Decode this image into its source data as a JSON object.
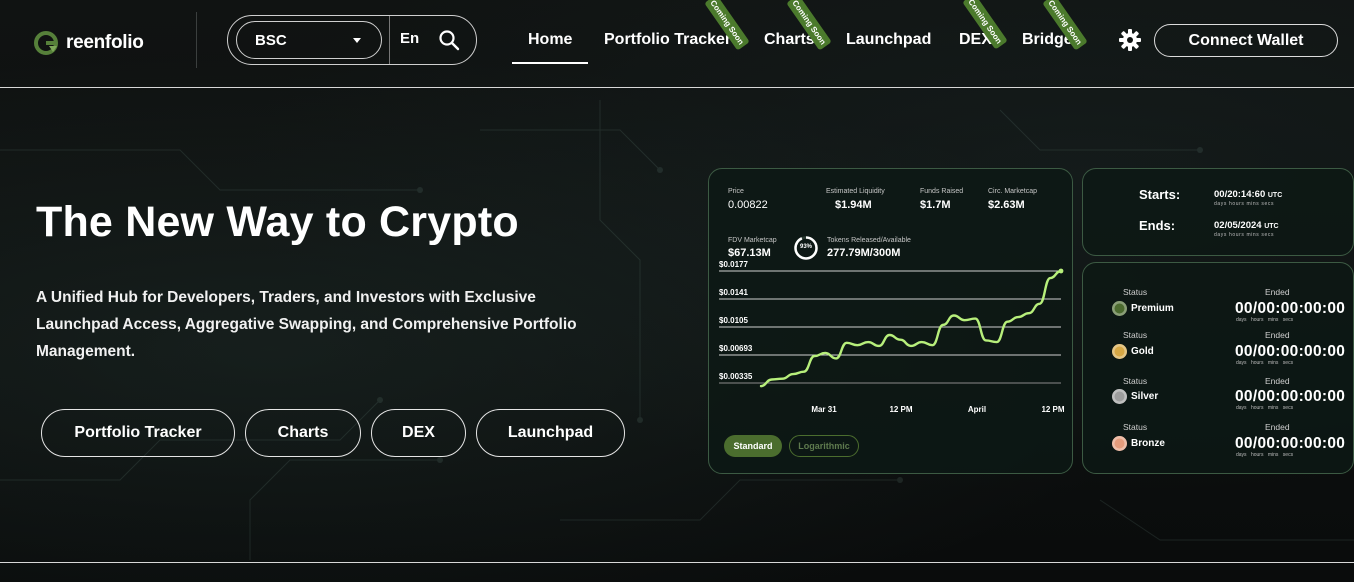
{
  "header": {
    "logo_text": "reenfolio",
    "chain": "BSC",
    "language": "En",
    "nav": [
      {
        "label": "Home",
        "active": true
      },
      {
        "label": "Portfolio Tracker",
        "badge": "Coming Soon"
      },
      {
        "label": "Charts",
        "badge": "Coming Soon"
      },
      {
        "label": "Launchpad"
      },
      {
        "label": "DEX",
        "badge": "Coming Soon"
      },
      {
        "label": "Bridge",
        "badge": "Coming Soon"
      }
    ],
    "connect_label": "Connect Wallet"
  },
  "hero": {
    "title": "The New Way to Crypto",
    "subtitle": "A Unified Hub for Developers, Traders, and Investors with Exclusive Launchpad Access, Aggregative Swapping, and Comprehensive Portfolio Management.",
    "buttons": [
      "Portfolio Tracker",
      "Charts",
      "DEX",
      "Launchpad"
    ]
  },
  "stats": {
    "price_label": "Price",
    "price": "0.00822",
    "liquidity_label": "Estimated Liquidity",
    "liquidity": "$1.94M",
    "funds_label": "Funds Raised",
    "funds": "$1.7M",
    "mcap_label": "Circ. Marketcap",
    "mcap": "$2.63M",
    "fdv_label": "FDV Marketcap",
    "fdv": "$67.13M",
    "released_percent": "93%",
    "tokens_label": "Tokens Released/Available",
    "tokens": "277.79M/300M"
  },
  "chart_data": {
    "type": "line",
    "y_ticks": [
      "$0.0177",
      "$0.0141",
      "$0.0105",
      "$0.00693",
      "$0.00335"
    ],
    "x_ticks": [
      "Mar 31",
      "12 PM",
      "April",
      "12 PM"
    ],
    "ylim": [
      0.00335,
      0.0177
    ],
    "series": [
      {
        "values": [
          0.00295,
          0.0038,
          0.0039,
          0.0045,
          0.0048,
          0.0068,
          0.0072,
          0.0065,
          0.0085,
          0.0082,
          0.0086,
          0.0081,
          0.0095,
          0.0089,
          0.0081,
          0.0086,
          0.0082,
          0.0108,
          0.012,
          0.0114,
          0.0116,
          0.0088,
          0.0086,
          0.0112,
          0.0118,
          0.0123,
          0.0135,
          0.0168,
          0.0177
        ]
      }
    ],
    "toggles": [
      "Standard",
      "Logarithmic"
    ],
    "line_color": "#b7ef7b"
  },
  "schedule": {
    "starts_label": "Starts:",
    "starts_time": "00/20:14:60",
    "starts_tz": "UTC",
    "ends_label": "Ends:",
    "ends_date": "02/05/2024",
    "ends_tz": "UTC",
    "units": "days hours mins secs"
  },
  "tiers": [
    {
      "status_label": "Status",
      "name": "Premium",
      "ended_label": "Ended",
      "countdown": "00/00:00:00:00",
      "color": "#4c6b2f"
    },
    {
      "status_label": "Status",
      "name": "Gold",
      "ended_label": "Ended",
      "countdown": "00/00:00:00:00",
      "color": "#d7a845"
    },
    {
      "status_label": "Status",
      "name": "Silver",
      "ended_label": "Ended",
      "countdown": "00/00:00:00:00",
      "color": "#9d9d9d"
    },
    {
      "status_label": "Status",
      "name": "Bronze",
      "ended_label": "Ended",
      "countdown": "00/00:00:00:00",
      "color": "#e59c7c"
    }
  ],
  "countdown_units": "days hours mins secs"
}
